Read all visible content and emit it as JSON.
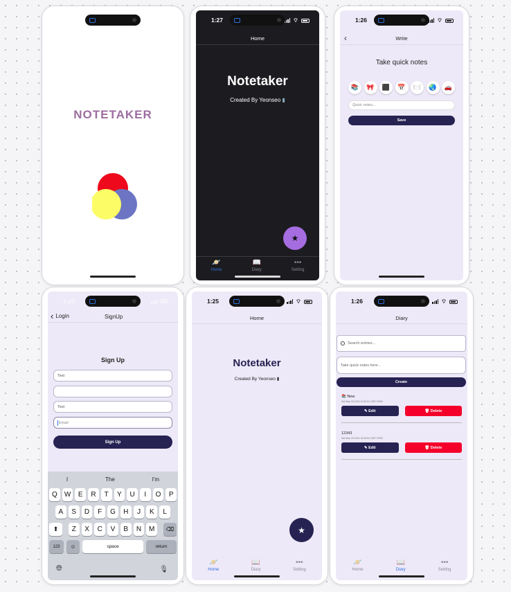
{
  "colors": {
    "accent": "#262252",
    "delete": "#f4002a",
    "fab_purple": "#a56de0",
    "screen_bg": "#eee9f8",
    "dark_bg": "#1c1b1f",
    "tab_active": "#2f6fe0"
  },
  "splash": {
    "logo_text": "NOTETAKER"
  },
  "home_dark": {
    "time": "1:27",
    "nav_title": "Home",
    "title": "Notetaker",
    "subtitle": "Created By Yeonseo",
    "fab_icon": "★"
  },
  "write": {
    "time": "1:26",
    "nav_title": "Write",
    "heading": "Take quick notes",
    "emojis": [
      "📚",
      "🎀",
      "⬛",
      "📅",
      "🍽️",
      "🌏",
      "🚗"
    ],
    "placeholder": "Quick notes...",
    "save_label": "Save"
  },
  "signup": {
    "time": "1:25",
    "back_label": "Login",
    "nav_title": "SignUp",
    "heading": "Sign Up",
    "fields": [
      "Test",
      "",
      "Test",
      "Email"
    ],
    "button_label": "Sign Up",
    "suggestions": [
      "I",
      "The",
      "I'm"
    ],
    "row1": [
      "Q",
      "W",
      "E",
      "R",
      "T",
      "Y",
      "U",
      "I",
      "O",
      "P"
    ],
    "row2": [
      "A",
      "S",
      "D",
      "F",
      "G",
      "H",
      "J",
      "K",
      "L"
    ],
    "row3": [
      "Z",
      "X",
      "C",
      "V",
      "B",
      "N",
      "M"
    ],
    "num_label": "123",
    "space_label": "space",
    "return_label": "return"
  },
  "home_light": {
    "time": "1:25",
    "nav_title": "Home",
    "title": "Notetaker",
    "subtitle": "Created By Yeonseo",
    "fab_icon": "★"
  },
  "diary": {
    "time": "1:26",
    "nav_title": "Diary",
    "search_placeholder": "Search entries...",
    "note_placeholder": "Take quick notes here...",
    "create_label": "Create",
    "entries": [
      {
        "title": "📚 New",
        "date": "Sat May 25 2024 13:30:51 GMT+0900",
        "edit": "Edit",
        "delete": "Delete"
      },
      {
        "title": "12343",
        "date": "Sat May 25 2024 18:06:54 GMT+0900",
        "edit": "Edit",
        "delete": "Delete"
      }
    ]
  },
  "tabs": {
    "home": "Home",
    "diary": "Diary",
    "setting": "Setting"
  }
}
